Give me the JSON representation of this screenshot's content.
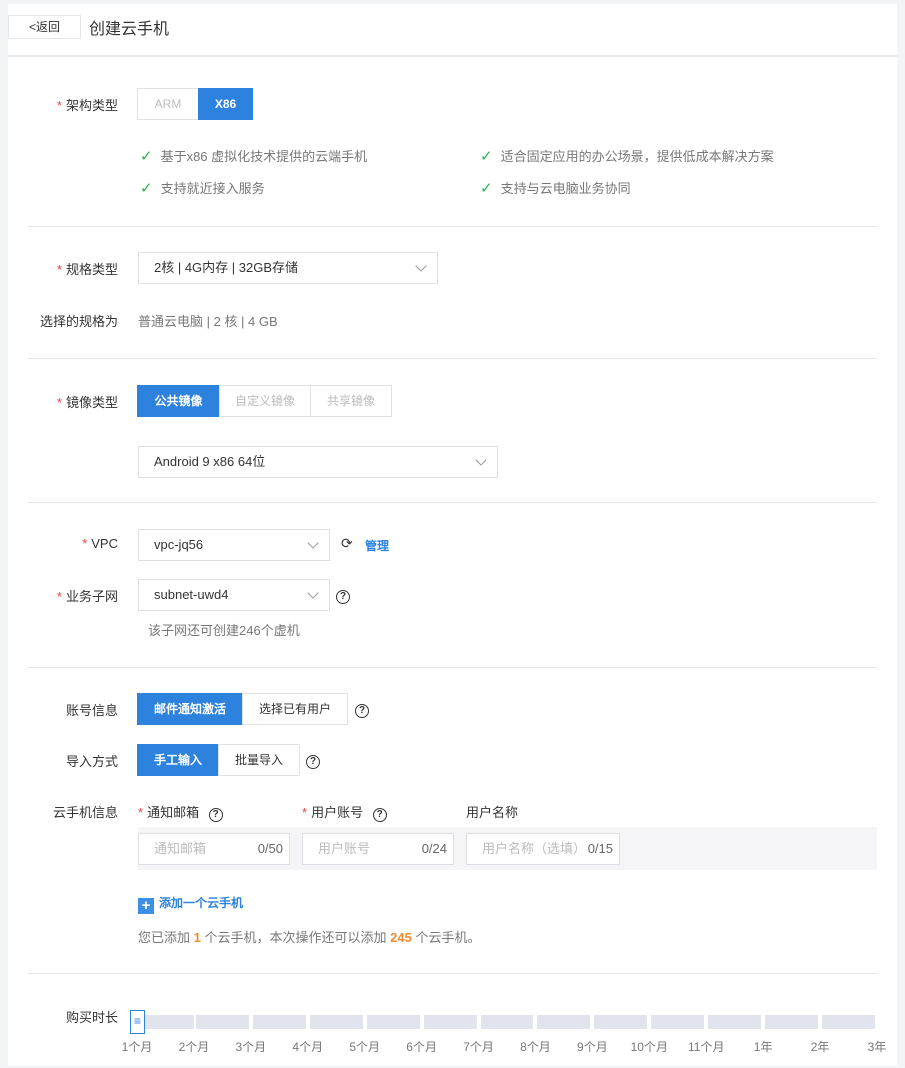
{
  "header": {
    "back": "<返回",
    "title": "创建云手机"
  },
  "arch": {
    "label": "架构类型",
    "options": [
      "ARM",
      "X86"
    ],
    "selected": "X86",
    "features": [
      "基于x86 虚拟化技术提供的云端手机",
      "适合固定应用的办公场景，提供低成本解决方案",
      "支持就近接入服务",
      "支持与云电脑业务协同"
    ]
  },
  "spec": {
    "label": "规格类型",
    "value": "2核 | 4G内存 | 32GB存储",
    "selected_label": "选择的规格为",
    "selected_value": "普通云电脑 | 2 核 | 4 GB"
  },
  "image": {
    "label": "镜像类型",
    "tabs": [
      "公共镜像",
      "自定义镜像",
      "共享镜像"
    ],
    "value": "Android 9 x86 64位"
  },
  "network": {
    "vpc_label": "VPC",
    "vpc_value": "vpc-jq56",
    "manage": "管理",
    "subnet_label": "业务子网",
    "subnet_value": "subnet-uwd4",
    "subnet_hint": "该子网还可创建246个虚机"
  },
  "account": {
    "label": "账号信息",
    "options": [
      "邮件通知激活",
      "选择已有用户"
    ],
    "import_label": "导入方式",
    "import_options": [
      "手工输入",
      "批量导入"
    ],
    "phone_label": "云手机信息",
    "cols": [
      "通知邮箱",
      "用户账号",
      "用户名称"
    ],
    "placeholders": [
      "通知邮箱",
      "用户账号",
      "用户名称（选填）"
    ],
    "counts": [
      "0/50",
      "0/24",
      "0/15"
    ],
    "add": "添加一个云手机",
    "summary_a": "您已添加",
    "added": "1",
    "summary_b": "个云手机，本次操作还可以添加",
    "remaining": "245",
    "summary_c": "个云手机。"
  },
  "duration": {
    "label": "购买时长",
    "ticks": [
      "1个月",
      "2个月",
      "3个月",
      "4个月",
      "5个月",
      "6个月",
      "7个月",
      "8个月",
      "9个月",
      "10个月",
      "11个月",
      "1年",
      "2年",
      "3年"
    ],
    "selected_index": 0
  }
}
